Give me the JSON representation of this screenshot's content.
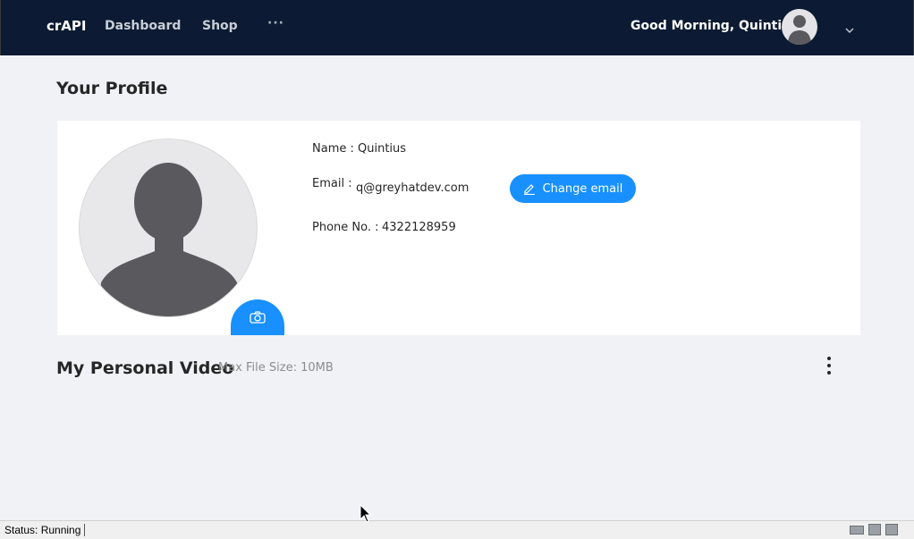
{
  "header": {
    "brand": "crAPI",
    "nav": [
      {
        "label": "Dashboard"
      },
      {
        "label": "Shop"
      },
      {
        "label": "···"
      }
    ],
    "greeting": "Good Morning, Quintius!",
    "avatar_icon": "user-avatar-icon",
    "menu_icon": "chevron-down-icon"
  },
  "profile": {
    "title": "Your Profile",
    "name_label": "Name :",
    "name_value": "Quintius",
    "email_label": "Email :",
    "email_value": "q@greyhatdev.com",
    "phone_label": "Phone No. :",
    "phone_value": "4322128959",
    "change_email_label": "Change email",
    "camera_icon": "camera-icon",
    "edit_icon": "edit-icon"
  },
  "video": {
    "title": "My Personal Video",
    "max_size": "Max File Size: 10MB",
    "menu_icon": "more-vertical-icon"
  },
  "statusbar": {
    "status": "Status: Running"
  },
  "colors": {
    "header_bg": "#0c1b33",
    "accent": "#1890ff",
    "page_bg": "#f0f2f5"
  }
}
